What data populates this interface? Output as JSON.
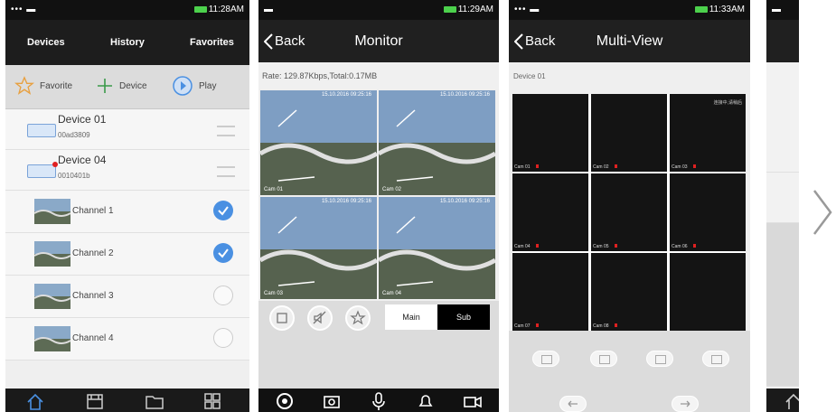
{
  "screen1": {
    "status_time": "11:28AM",
    "tabs": [
      "Devices",
      "History",
      "Favorites"
    ],
    "toolbar": {
      "favorite": "Favorite",
      "device": "Device",
      "play": "Play"
    },
    "devices": [
      {
        "name": "Device 01",
        "id": "00ad3809"
      },
      {
        "name": "Device 04",
        "id": "0010401b"
      }
    ],
    "channels": [
      {
        "label": "Channel 1",
        "checked": true
      },
      {
        "label": "Channel 2",
        "checked": true
      },
      {
        "label": "Channel 3",
        "checked": false
      },
      {
        "label": "Channel 4",
        "checked": false
      }
    ]
  },
  "screen2": {
    "status_time": "11:29AM",
    "back": "Back",
    "title": "Monitor",
    "rate": "Rate: 129.87Kbps,Total:0.17MB",
    "cells": [
      {
        "cam": "Cam 01",
        "ts": "15.10.2016 09:25:16"
      },
      {
        "cam": "Cam 02",
        "ts": "15.10.2016 09:25:16"
      },
      {
        "cam": "Cam 03",
        "ts": "15.10.2016 09:25:16"
      },
      {
        "cam": "Cam 04",
        "ts": "15.10.2016 09:25:16"
      }
    ],
    "stream_main": "Main",
    "stream_sub": "Sub"
  },
  "screen3": {
    "status_time": "11:33AM",
    "back": "Back",
    "title": "Multi-View",
    "device_label": "Device 01",
    "corner_text": "连接中,请稍后",
    "cams": [
      "Cam 01",
      "Cam 02",
      "Cam 03",
      "Cam 04",
      "Cam 05",
      "Cam 06",
      "Cam 07",
      "Cam 08",
      ""
    ]
  },
  "colors": {
    "accent": "#4a90e2",
    "bar": "#202020",
    "record": "#e02020"
  }
}
